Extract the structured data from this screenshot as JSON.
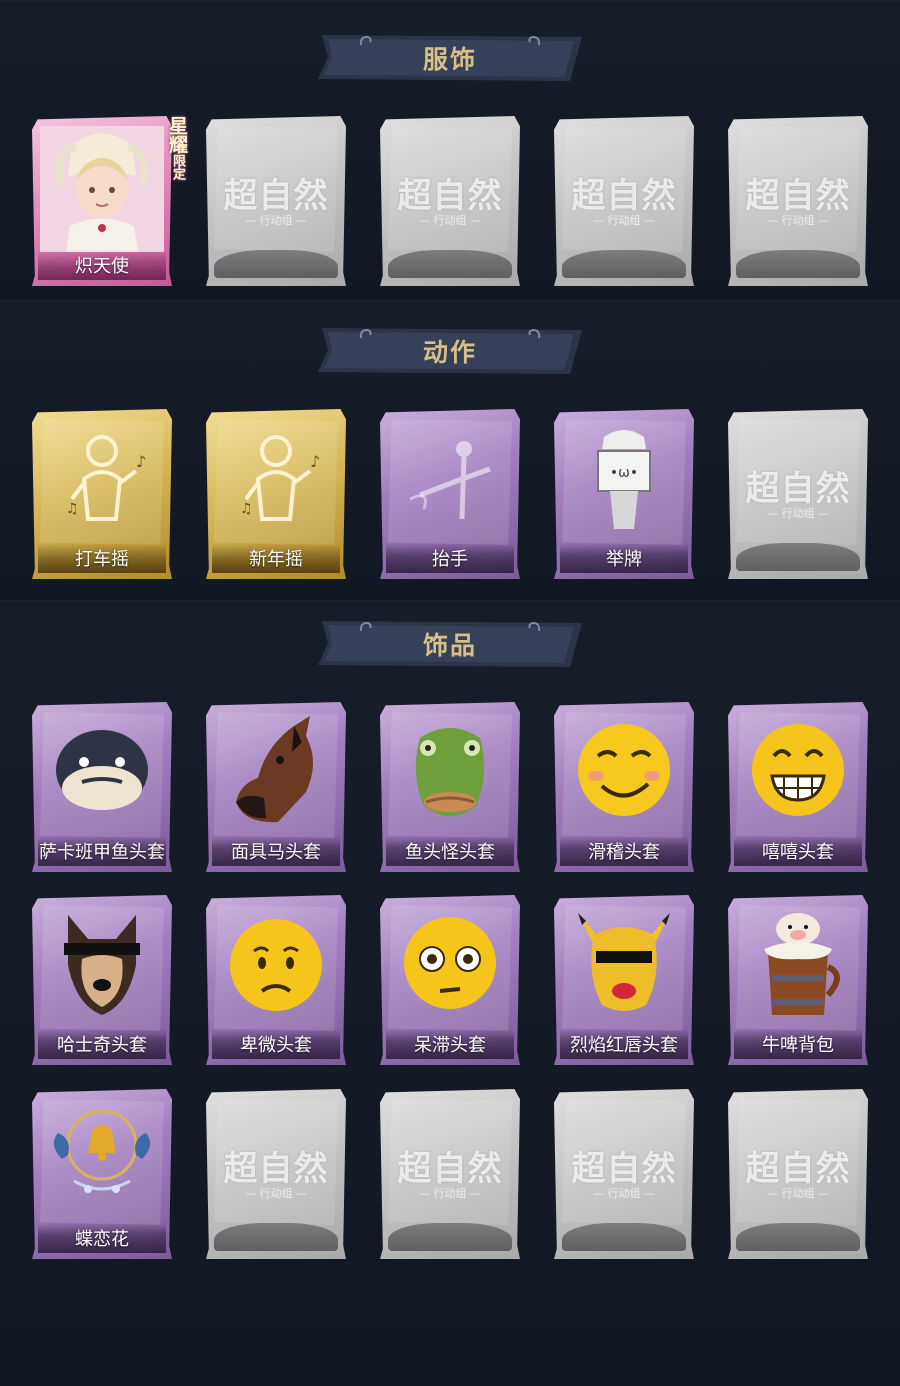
{
  "sections": [
    {
      "title": "服饰",
      "items": [
        {
          "label": "炽天使",
          "rarity": "pink",
          "art": "angel-portrait",
          "badge": [
            "星耀",
            "限定"
          ]
        },
        {
          "label": "",
          "rarity": "grey",
          "art": "placeholder"
        },
        {
          "label": "",
          "rarity": "grey",
          "art": "placeholder"
        },
        {
          "label": "",
          "rarity": "grey",
          "art": "placeholder"
        },
        {
          "label": "",
          "rarity": "grey",
          "art": "placeholder"
        }
      ]
    },
    {
      "title": "动作",
      "items": [
        {
          "label": "打车摇",
          "rarity": "gold",
          "art": "dance-figure-icon"
        },
        {
          "label": "新年摇",
          "rarity": "gold",
          "art": "dance-figure-icon"
        },
        {
          "label": "抬手",
          "rarity": "purple",
          "art": "raise-hand-icon"
        },
        {
          "label": "举牌",
          "rarity": "purple",
          "art": "hold-sign-icon"
        },
        {
          "label": "",
          "rarity": "grey",
          "art": "placeholder"
        }
      ]
    },
    {
      "title": "饰品",
      "items": [
        {
          "label": "萨卡班甲鱼头套",
          "rarity": "purple",
          "art": "fish-head"
        },
        {
          "label": "面具马头套",
          "rarity": "purple",
          "art": "horse-head"
        },
        {
          "label": "鱼头怪头套",
          "rarity": "purple",
          "art": "fishman-head"
        },
        {
          "label": "滑稽头套",
          "rarity": "purple",
          "art": "smirk-emoji"
        },
        {
          "label": "嘻嘻头套",
          "rarity": "purple",
          "art": "grin-emoji"
        },
        {
          "label": "哈士奇头套",
          "rarity": "purple",
          "art": "husky-head"
        },
        {
          "label": "卑微头套",
          "rarity": "purple",
          "art": "humble-emoji"
        },
        {
          "label": "呆滞头套",
          "rarity": "purple",
          "art": "stunned-emoji"
        },
        {
          "label": "烈焰红唇头套",
          "rarity": "purple",
          "art": "pikachu-head"
        },
        {
          "label": "牛啤背包",
          "rarity": "purple",
          "art": "cow-beer"
        },
        {
          "label": "蝶恋花",
          "rarity": "purple",
          "art": "bell-ornament"
        },
        {
          "label": "",
          "rarity": "grey",
          "art": "placeholder"
        },
        {
          "label": "",
          "rarity": "grey",
          "art": "placeholder"
        },
        {
          "label": "",
          "rarity": "grey",
          "art": "placeholder"
        },
        {
          "label": "",
          "rarity": "grey",
          "art": "placeholder"
        }
      ]
    }
  ],
  "placeholder": {
    "title": "超自然",
    "subtitle": "— 行动组 —"
  }
}
